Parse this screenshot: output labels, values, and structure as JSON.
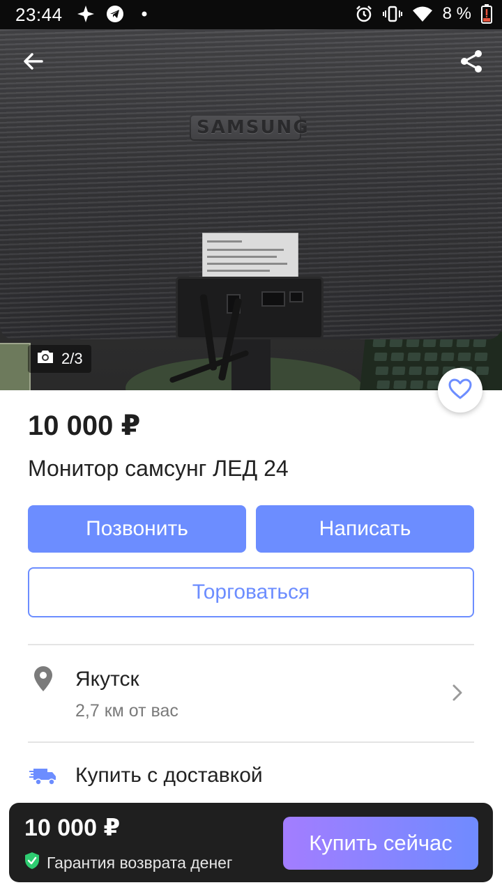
{
  "status_bar": {
    "time": "23:44",
    "battery_percent": "8 %",
    "left_icons": [
      "spark-icon",
      "telegram-icon",
      "dot-icon"
    ],
    "right_icons": [
      "alarm-icon",
      "vibrate-icon",
      "wifi-icon",
      "battery-low-icon"
    ]
  },
  "gallery": {
    "counter": "2/3",
    "brand_on_photo": "SAMSUNG",
    "icons": [
      "back-arrow-icon",
      "share-icon",
      "camera-icon",
      "heart-icon"
    ]
  },
  "listing": {
    "price": "10 000 ₽",
    "title": "Монитор самсунг ЛЕД 24"
  },
  "actions": {
    "call_label": "Позвонить",
    "write_label": "Написать",
    "bargain_label": "Торговаться"
  },
  "location": {
    "city": "Якутск",
    "distance": "2,7 км от вас"
  },
  "delivery": {
    "label": "Купить с доставкой"
  },
  "bottom_bar": {
    "price": "10 000 ₽",
    "guarantee": "Гарантия возврата денег",
    "buy_label": "Купить сейчас"
  },
  "colors": {
    "accent": "#6c8dff",
    "buy_gradient_start": "#a37dff",
    "buy_gradient_end": "#6f8bff",
    "guarantee_green": "#2ecc71",
    "battery_red": "#e5533d"
  }
}
